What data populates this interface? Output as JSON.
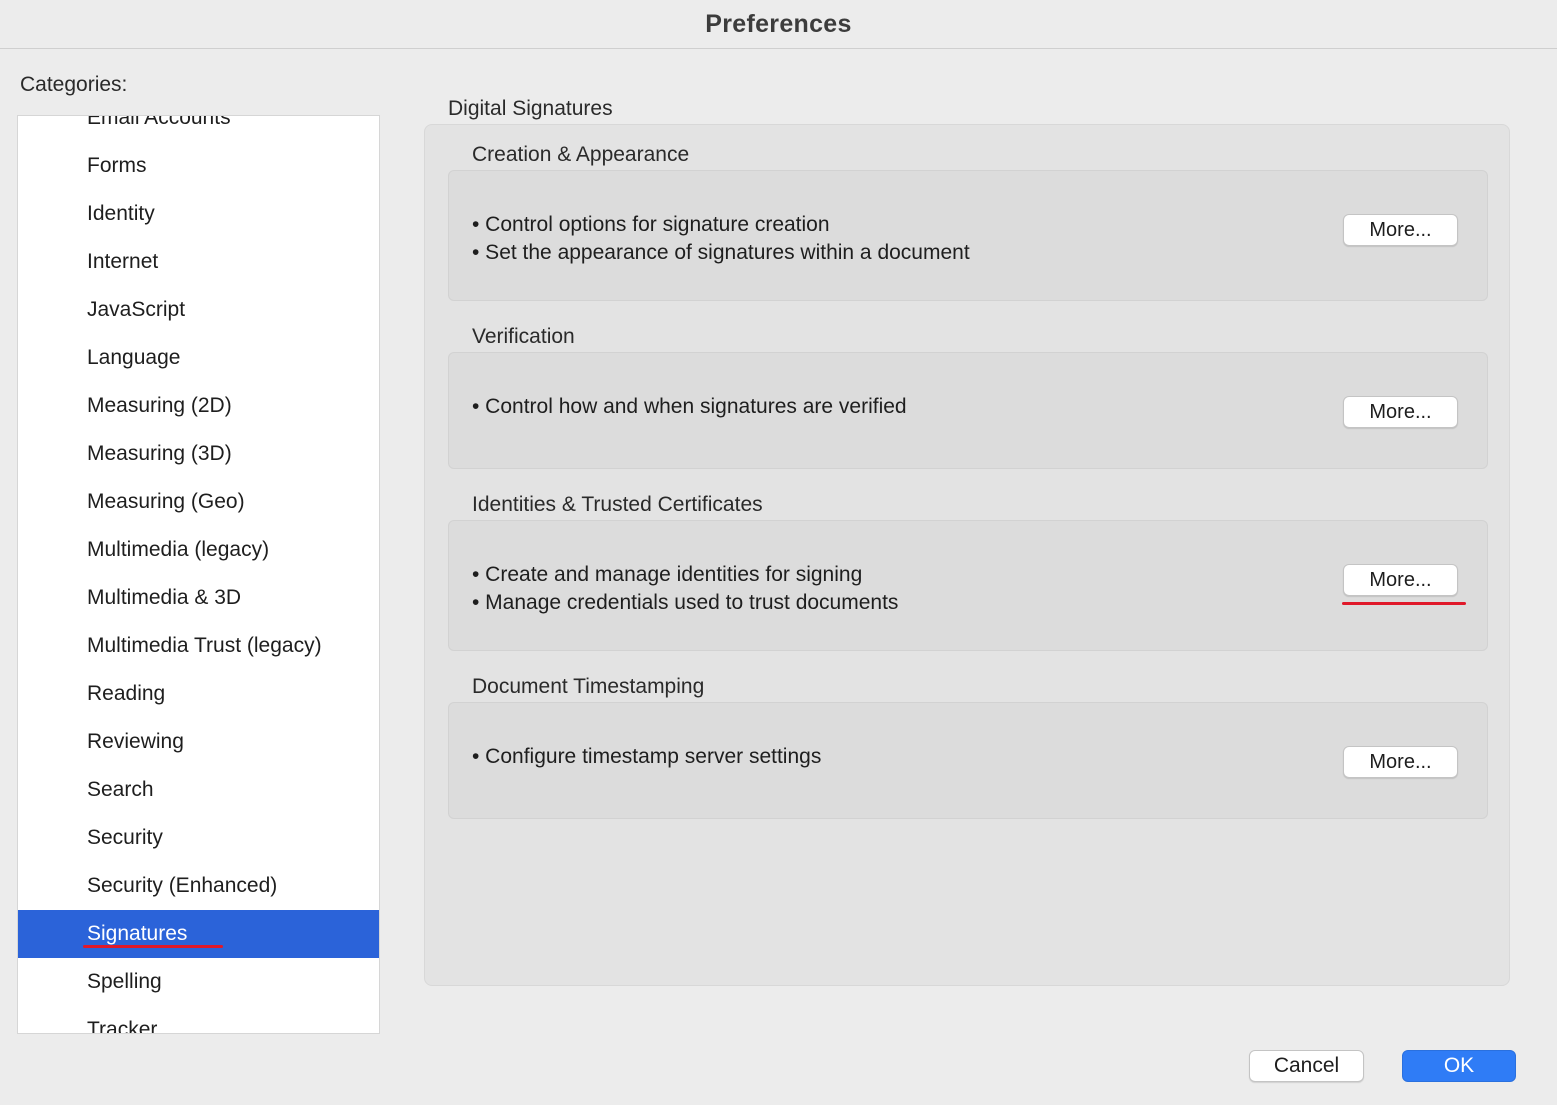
{
  "window": {
    "title": "Preferences"
  },
  "categories": {
    "label": "Categories:",
    "items": [
      "Email Accounts",
      "Forms",
      "Identity",
      "Internet",
      "JavaScript",
      "Language",
      "Measuring (2D)",
      "Measuring (3D)",
      "Measuring (Geo)",
      "Multimedia (legacy)",
      "Multimedia & 3D",
      "Multimedia Trust (legacy)",
      "Reading",
      "Reviewing",
      "Search",
      "Security",
      "Security (Enhanced)",
      "Signatures",
      "Spelling",
      "Tracker"
    ],
    "selected": "Signatures"
  },
  "panel": {
    "title": "Digital Signatures",
    "groups": [
      {
        "title": "Creation & Appearance",
        "bullets": [
          "• Control options for signature creation",
          "• Set the appearance of signatures within a document"
        ],
        "button": "More..."
      },
      {
        "title": "Verification",
        "bullets": [
          "• Control how and when signatures are verified"
        ],
        "button": "More..."
      },
      {
        "title": "Identities & Trusted Certificates",
        "bullets": [
          "• Create and manage identities for signing",
          "• Manage credentials used to trust documents"
        ],
        "button": "More..."
      },
      {
        "title": "Document Timestamping",
        "bullets": [
          "• Configure timestamp server settings"
        ],
        "button": "More..."
      }
    ]
  },
  "footer": {
    "cancel": "Cancel",
    "ok": "OK"
  },
  "colors": {
    "selection": "#2b63d9",
    "primary_button": "#2f7cf6",
    "annotation": "#e0192a"
  }
}
